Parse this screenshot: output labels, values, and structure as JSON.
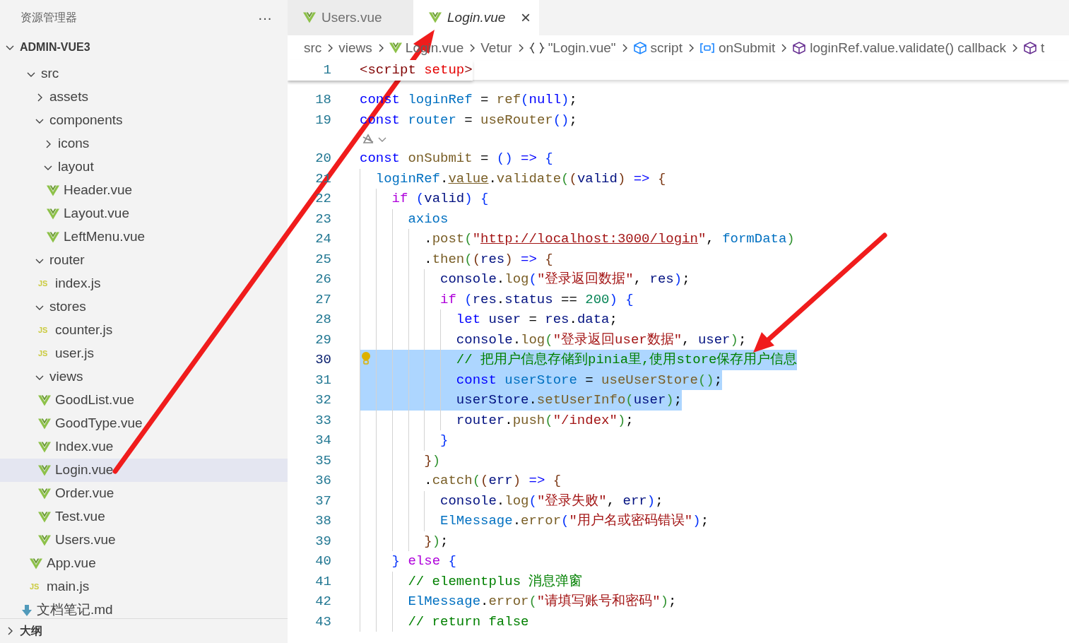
{
  "sidebar": {
    "title": "资源管理器",
    "more": "···",
    "project": {
      "label": "ADMIN-VUE3",
      "expanded": true
    },
    "tree": [
      {
        "label": "src",
        "kind": "folder",
        "expanded": true,
        "selected": false,
        "children": [
          {
            "label": "assets",
            "kind": "folder",
            "expanded": false,
            "selected": false
          },
          {
            "label": "components",
            "kind": "folder",
            "expanded": true,
            "selected": false,
            "children": [
              {
                "label": "icons",
                "kind": "folder",
                "expanded": false,
                "selected": false
              },
              {
                "label": "layout",
                "kind": "folder",
                "expanded": true,
                "selected": false,
                "children": [
                  {
                    "label": "Header.vue",
                    "kind": "vue",
                    "selected": false
                  },
                  {
                    "label": "Layout.vue",
                    "kind": "vue",
                    "selected": false
                  },
                  {
                    "label": "LeftMenu.vue",
                    "kind": "vue",
                    "selected": false
                  }
                ]
              }
            ]
          },
          {
            "label": "router",
            "kind": "folder",
            "expanded": true,
            "selected": false,
            "children": [
              {
                "label": "index.js",
                "kind": "js",
                "badge": "JS",
                "selected": false
              }
            ]
          },
          {
            "label": "stores",
            "kind": "folder",
            "expanded": true,
            "selected": false,
            "children": [
              {
                "label": "counter.js",
                "kind": "js",
                "badge": "JS",
                "selected": false
              },
              {
                "label": "user.js",
                "kind": "js",
                "badge": "JS",
                "selected": false
              }
            ]
          },
          {
            "label": "views",
            "kind": "folder",
            "expanded": true,
            "selected": false,
            "children": [
              {
                "label": "GoodList.vue",
                "kind": "vue",
                "selected": false
              },
              {
                "label": "GoodType.vue",
                "kind": "vue",
                "selected": false
              },
              {
                "label": "Index.vue",
                "kind": "vue",
                "selected": false
              },
              {
                "label": "Login.vue",
                "kind": "vue",
                "selected": true
              },
              {
                "label": "Order.vue",
                "kind": "vue",
                "selected": false
              },
              {
                "label": "Test.vue",
                "kind": "vue",
                "selected": false
              },
              {
                "label": "Users.vue",
                "kind": "vue",
                "selected": false
              }
            ]
          },
          {
            "label": "App.vue",
            "kind": "vue",
            "selected": false
          },
          {
            "label": "main.js",
            "kind": "js",
            "badge": "JS",
            "selected": false
          }
        ]
      },
      {
        "label": "文档笔记.md",
        "kind": "md",
        "selected": false
      }
    ],
    "outline": {
      "label": "大纲",
      "expanded": false
    }
  },
  "tabs": [
    {
      "label": "Users.vue",
      "selected": false,
      "preview": false
    },
    {
      "label": "Login.vue",
      "selected": true,
      "preview": true,
      "close": "×"
    }
  ],
  "breadcrumb": [
    {
      "kind": "text",
      "label": "src"
    },
    {
      "kind": "text",
      "label": "views"
    },
    {
      "kind": "vue",
      "label": "Login.vue"
    },
    {
      "kind": "text",
      "label": "Vetur"
    },
    {
      "kind": "braces",
      "label": "\"Login.vue\""
    },
    {
      "kind": "module",
      "label": "script"
    },
    {
      "kind": "variable",
      "label": "onSubmit"
    },
    {
      "kind": "method",
      "label": "loginRef.value.validate() callback"
    },
    {
      "kind": "method",
      "label": "t"
    }
  ],
  "sticky": {
    "number": "1",
    "tokens": [
      {
        "kind": "tag",
        "text": "<script "
      },
      {
        "kind": "attr",
        "text": "setup"
      },
      {
        "kind": "tag",
        "text": ">"
      }
    ]
  },
  "lines": [
    {
      "kind": "code",
      "number": "18",
      "selected": false,
      "lightbulb": false,
      "tokens": [
        {
          "kind": "kw",
          "text": "const "
        },
        {
          "kind": "const",
          "text": "loginRef"
        },
        {
          "kind": "p",
          "text": " = "
        },
        {
          "kind": "fn",
          "text": "ref"
        },
        {
          "kind": "b1",
          "text": "("
        },
        {
          "kind": "kw",
          "text": "null"
        },
        {
          "kind": "b1",
          "text": ")"
        },
        {
          "kind": "p",
          "text": ";"
        }
      ]
    },
    {
      "kind": "code",
      "number": "19",
      "selected": false,
      "lightbulb": false,
      "tokens": [
        {
          "kind": "kw",
          "text": "const "
        },
        {
          "kind": "const",
          "text": "router"
        },
        {
          "kind": "p",
          "text": " = "
        },
        {
          "kind": "fn",
          "text": "useRouter"
        },
        {
          "kind": "b1",
          "text": "()"
        },
        {
          "kind": "p",
          "text": ";"
        }
      ]
    },
    {
      "kind": "codelens"
    },
    {
      "kind": "code",
      "number": "20",
      "selected": false,
      "lightbulb": false,
      "tokens": [
        {
          "kind": "kw",
          "text": "const "
        },
        {
          "kind": "fn",
          "text": "onSubmit"
        },
        {
          "kind": "p",
          "text": " = "
        },
        {
          "kind": "b1",
          "text": "() "
        },
        {
          "kind": "kw",
          "text": "=> "
        },
        {
          "kind": "b1",
          "text": "{"
        }
      ]
    },
    {
      "kind": "code",
      "number": "21",
      "selected": false,
      "lightbulb": false,
      "tokens": [
        {
          "kind": "const",
          "text": "  loginRef"
        },
        {
          "kind": "p",
          "text": "."
        },
        {
          "kind": "warn",
          "text": "value"
        },
        {
          "kind": "p",
          "text": "."
        },
        {
          "kind": "fn",
          "text": "validate"
        },
        {
          "kind": "b2",
          "text": "("
        },
        {
          "kind": "b3",
          "text": "("
        },
        {
          "kind": "var",
          "text": "valid"
        },
        {
          "kind": "b3",
          "text": ") "
        },
        {
          "kind": "kw",
          "text": "=> "
        },
        {
          "kind": "b3",
          "text": "{"
        }
      ]
    },
    {
      "kind": "code",
      "number": "22",
      "selected": false,
      "lightbulb": false,
      "tokens": [
        {
          "kind": "ctl",
          "text": "    if "
        },
        {
          "kind": "b1",
          "text": "("
        },
        {
          "kind": "var",
          "text": "valid"
        },
        {
          "kind": "b1",
          "text": ") {"
        }
      ]
    },
    {
      "kind": "code",
      "number": "23",
      "selected": false,
      "lightbulb": false,
      "tokens": [
        {
          "kind": "const",
          "text": "      axios"
        }
      ]
    },
    {
      "kind": "code",
      "number": "24",
      "selected": false,
      "lightbulb": false,
      "tokens": [
        {
          "kind": "p",
          "text": "        ."
        },
        {
          "kind": "fn",
          "text": "post"
        },
        {
          "kind": "b2",
          "text": "("
        },
        {
          "kind": "str",
          "text": "\""
        },
        {
          "kind": "link",
          "text": "http://localhost:3000/login"
        },
        {
          "kind": "str",
          "text": "\""
        },
        {
          "kind": "p",
          "text": ", "
        },
        {
          "kind": "const",
          "text": "formData"
        },
        {
          "kind": "b2",
          "text": ")"
        }
      ]
    },
    {
      "kind": "code",
      "number": "25",
      "selected": false,
      "lightbulb": false,
      "tokens": [
        {
          "kind": "p",
          "text": "        ."
        },
        {
          "kind": "fn",
          "text": "then"
        },
        {
          "kind": "b2",
          "text": "("
        },
        {
          "kind": "b3",
          "text": "("
        },
        {
          "kind": "var",
          "text": "res"
        },
        {
          "kind": "b3",
          "text": ") "
        },
        {
          "kind": "kw",
          "text": "=> "
        },
        {
          "kind": "b3",
          "text": "{"
        }
      ]
    },
    {
      "kind": "code",
      "number": "26",
      "selected": false,
      "lightbulb": false,
      "tokens": [
        {
          "kind": "var",
          "text": "          console"
        },
        {
          "kind": "p",
          "text": "."
        },
        {
          "kind": "fn",
          "text": "log"
        },
        {
          "kind": "b1",
          "text": "("
        },
        {
          "kind": "str",
          "text": "\"登录返回数据\""
        },
        {
          "kind": "p",
          "text": ", "
        },
        {
          "kind": "var",
          "text": "res"
        },
        {
          "kind": "b1",
          "text": ")"
        },
        {
          "kind": "p",
          "text": ";"
        }
      ]
    },
    {
      "kind": "code",
      "number": "27",
      "selected": false,
      "lightbulb": false,
      "tokens": [
        {
          "kind": "ctl",
          "text": "          if "
        },
        {
          "kind": "b1",
          "text": "("
        },
        {
          "kind": "var",
          "text": "res"
        },
        {
          "kind": "p",
          "text": "."
        },
        {
          "kind": "var",
          "text": "status"
        },
        {
          "kind": "p",
          "text": " == "
        },
        {
          "kind": "num",
          "text": "200"
        },
        {
          "kind": "b1",
          "text": ") {"
        }
      ]
    },
    {
      "kind": "code",
      "number": "28",
      "selected": false,
      "lightbulb": false,
      "tokens": [
        {
          "kind": "kw",
          "text": "            let "
        },
        {
          "kind": "var",
          "text": "user"
        },
        {
          "kind": "p",
          "text": " = "
        },
        {
          "kind": "var",
          "text": "res"
        },
        {
          "kind": "p",
          "text": "."
        },
        {
          "kind": "var",
          "text": "data"
        },
        {
          "kind": "p",
          "text": ";"
        }
      ]
    },
    {
      "kind": "code",
      "number": "29",
      "selected": false,
      "lightbulb": false,
      "tokens": [
        {
          "kind": "var",
          "text": "            console"
        },
        {
          "kind": "p",
          "text": "."
        },
        {
          "kind": "fn",
          "text": "log"
        },
        {
          "kind": "b2",
          "text": "("
        },
        {
          "kind": "str",
          "text": "\"登录返回user数据\""
        },
        {
          "kind": "p",
          "text": ", "
        },
        {
          "kind": "var",
          "text": "user"
        },
        {
          "kind": "b2",
          "text": ")"
        },
        {
          "kind": "p",
          "text": ";"
        }
      ]
    },
    {
      "kind": "code",
      "number": "30",
      "selected": true,
      "lightbulb": true,
      "tokens": [
        {
          "kind": "com",
          "text": "            // 把用户信息存储到pinia里,使用store保存用户信息"
        }
      ]
    },
    {
      "kind": "code",
      "number": "31",
      "selected": true,
      "lightbulb": false,
      "tokens": [
        {
          "kind": "kw",
          "text": "            const "
        },
        {
          "kind": "const",
          "text": "userStore"
        },
        {
          "kind": "p",
          "text": " = "
        },
        {
          "kind": "fn",
          "text": "useUserStore"
        },
        {
          "kind": "b2",
          "text": "()"
        },
        {
          "kind": "p",
          "text": ";"
        }
      ]
    },
    {
      "kind": "code",
      "number": "32",
      "selected": true,
      "lightbulb": false,
      "tokens": [
        {
          "kind": "var",
          "text": "            userStore"
        },
        {
          "kind": "p",
          "text": "."
        },
        {
          "kind": "fn",
          "text": "setUserInfo"
        },
        {
          "kind": "b2",
          "text": "("
        },
        {
          "kind": "var",
          "text": "user"
        },
        {
          "kind": "b2",
          "text": ")"
        },
        {
          "kind": "p",
          "text": ";"
        }
      ]
    },
    {
      "kind": "code",
      "number": "33",
      "selected": false,
      "lightbulb": false,
      "tokens": [
        {
          "kind": "var",
          "text": "            router"
        },
        {
          "kind": "p",
          "text": "."
        },
        {
          "kind": "fn",
          "text": "push"
        },
        {
          "kind": "b2",
          "text": "("
        },
        {
          "kind": "str",
          "text": "\"/index\""
        },
        {
          "kind": "b2",
          "text": ")"
        },
        {
          "kind": "p",
          "text": ";"
        }
      ]
    },
    {
      "kind": "code",
      "number": "34",
      "selected": false,
      "lightbulb": false,
      "tokens": [
        {
          "kind": "b1",
          "text": "          }"
        }
      ]
    },
    {
      "kind": "code",
      "number": "35",
      "selected": false,
      "lightbulb": false,
      "tokens": [
        {
          "kind": "b3",
          "text": "        }"
        },
        {
          "kind": "b2",
          "text": ")"
        }
      ]
    },
    {
      "kind": "code",
      "number": "36",
      "selected": false,
      "lightbulb": false,
      "tokens": [
        {
          "kind": "p",
          "text": "        ."
        },
        {
          "kind": "fn",
          "text": "catch"
        },
        {
          "kind": "b2",
          "text": "("
        },
        {
          "kind": "b3",
          "text": "("
        },
        {
          "kind": "var",
          "text": "err"
        },
        {
          "kind": "b3",
          "text": ") "
        },
        {
          "kind": "kw",
          "text": "=> "
        },
        {
          "kind": "b3",
          "text": "{"
        }
      ]
    },
    {
      "kind": "code",
      "number": "37",
      "selected": false,
      "lightbulb": false,
      "tokens": [
        {
          "kind": "var",
          "text": "          console"
        },
        {
          "kind": "p",
          "text": "."
        },
        {
          "kind": "fn",
          "text": "log"
        },
        {
          "kind": "b1",
          "text": "("
        },
        {
          "kind": "str",
          "text": "\"登录失败\""
        },
        {
          "kind": "p",
          "text": ", "
        },
        {
          "kind": "var",
          "text": "err"
        },
        {
          "kind": "b1",
          "text": ")"
        },
        {
          "kind": "p",
          "text": ";"
        }
      ]
    },
    {
      "kind": "code",
      "number": "38",
      "selected": false,
      "lightbulb": false,
      "tokens": [
        {
          "kind": "const",
          "text": "          ElMessage"
        },
        {
          "kind": "p",
          "text": "."
        },
        {
          "kind": "fn",
          "text": "error"
        },
        {
          "kind": "b1",
          "text": "("
        },
        {
          "kind": "str",
          "text": "\"用户名或密码错误\""
        },
        {
          "kind": "b1",
          "text": ")"
        },
        {
          "kind": "p",
          "text": ";"
        }
      ]
    },
    {
      "kind": "code",
      "number": "39",
      "selected": false,
      "lightbulb": false,
      "tokens": [
        {
          "kind": "b3",
          "text": "        }"
        },
        {
          "kind": "b2",
          "text": ")"
        },
        {
          "kind": "p",
          "text": ";"
        }
      ]
    },
    {
      "kind": "code",
      "number": "40",
      "selected": false,
      "lightbulb": false,
      "tokens": [
        {
          "kind": "b1",
          "text": "    } "
        },
        {
          "kind": "ctl",
          "text": "else "
        },
        {
          "kind": "b1",
          "text": "{"
        }
      ]
    },
    {
      "kind": "code",
      "number": "41",
      "selected": false,
      "lightbulb": false,
      "tokens": [
        {
          "kind": "com",
          "text": "      // elementplus 消息弹窗"
        }
      ]
    },
    {
      "kind": "code",
      "number": "42",
      "selected": false,
      "lightbulb": false,
      "tokens": [
        {
          "kind": "const",
          "text": "      ElMessage"
        },
        {
          "kind": "p",
          "text": "."
        },
        {
          "kind": "fn",
          "text": "error"
        },
        {
          "kind": "b2",
          "text": "("
        },
        {
          "kind": "str",
          "text": "\"请填写账号和密码\""
        },
        {
          "kind": "b2",
          "text": ")"
        },
        {
          "kind": "p",
          "text": ";"
        }
      ]
    },
    {
      "kind": "code",
      "number": "43",
      "selected": false,
      "lightbulb": false,
      "tokens": [
        {
          "kind": "com",
          "text": "      // return false"
        }
      ]
    }
  ]
}
